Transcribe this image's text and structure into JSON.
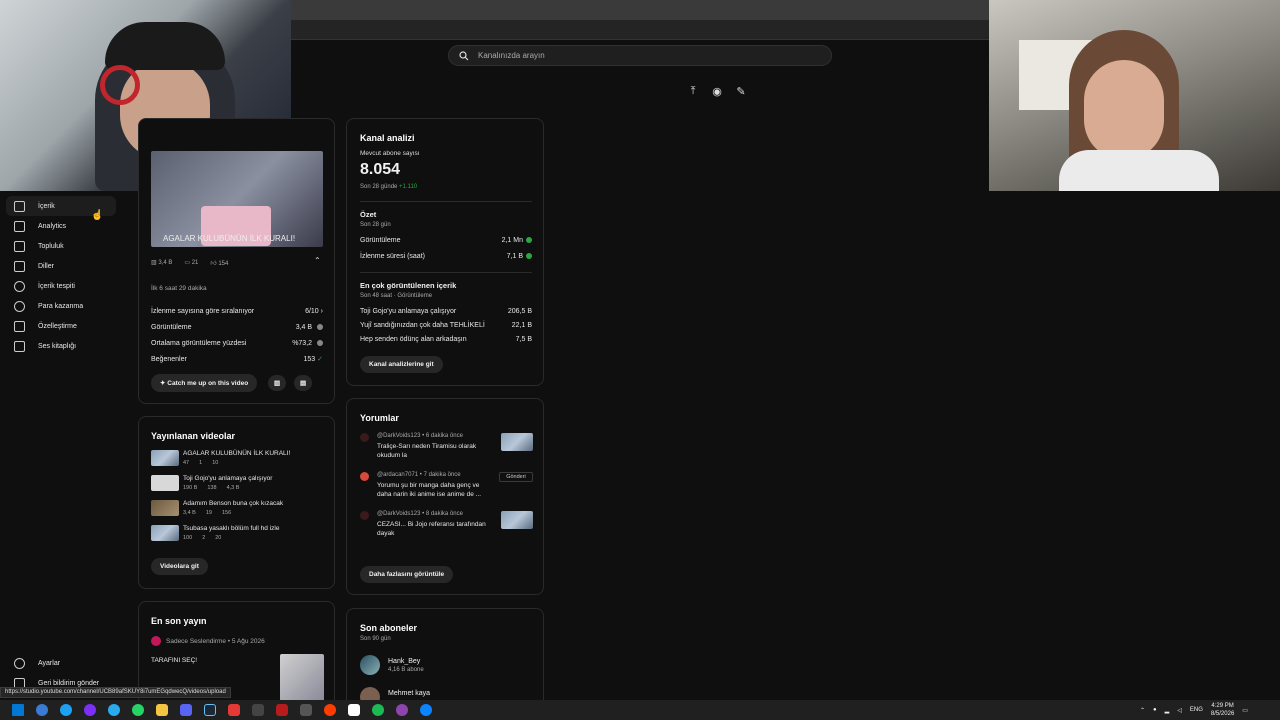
{
  "search": {
    "placeholder": "Kanalınızda arayın"
  },
  "sidebar": {
    "items": [
      {
        "label": "İçerik",
        "icon": "content-icon"
      },
      {
        "label": "Analytics",
        "icon": "analytics-icon"
      },
      {
        "label": "Topluluk",
        "icon": "community-icon"
      },
      {
        "label": "Diller",
        "icon": "subtitles-icon"
      },
      {
        "label": "İçerik tespiti",
        "icon": "copyright-icon"
      },
      {
        "label": "Para kazanma",
        "icon": "dollar-icon"
      },
      {
        "label": "Özelleştirme",
        "icon": "customize-icon"
      },
      {
        "label": "Ses kitaplığı",
        "icon": "audio-library-icon"
      }
    ],
    "settings": "Ayarlar",
    "feedback": "Geri bildirim gönder"
  },
  "latest_video": {
    "title": "AGALAR KULUBÜNÜN İLK KURALI!",
    "views": "3,4 B",
    "comments": "21",
    "likes": "154",
    "period": "İlk 6 saat 29 dakika",
    "rows": [
      {
        "label": "İzlenme sayısına göre sıralanıyor",
        "value": "6/10"
      },
      {
        "label": "Görüntüleme",
        "value": "3,4 B"
      },
      {
        "label": "Ortalama görüntüleme yüzdesi",
        "value": "%73,2"
      },
      {
        "label": "Beğenenler",
        "value": "153"
      }
    ],
    "catch_button": "Catch me up on this video"
  },
  "published": {
    "title": "Yayınlanan videolar",
    "videos": [
      {
        "title": "AGALAR KULUBÜNÜN İLK KURALI!",
        "views": "47",
        "comments": "1",
        "likes": "10"
      },
      {
        "title": "Toji Gojo'yu anlamaya çalışıyor",
        "views": "190 B",
        "comments": "138",
        "likes": "4,3 B"
      },
      {
        "title": "Adamım Benson buna çok kızacak",
        "views": "3,4 B",
        "comments": "19",
        "likes": "156"
      },
      {
        "title": "Tsubasa yasaklı bölüm full hd izle",
        "views": "100",
        "comments": "2",
        "likes": "20"
      }
    ],
    "button": "Videolara git"
  },
  "latest_post": {
    "title": "En son yayın",
    "author": "Sadece Seslendirme",
    "date": "5 Ağu 2026",
    "text": "TARAFINI SEÇ!"
  },
  "analytics": {
    "title": "Kanal analizi",
    "subs_label": "Mevcut abone sayısı",
    "subs_value": "8.054",
    "subs_change_prefix": "Son 28 günde",
    "subs_change": "+1.110",
    "summary_title": "Özet",
    "summary_period": "Son 28 gün",
    "summary_rows": [
      {
        "label": "Görüntüleme",
        "value": "2,1 Mn"
      },
      {
        "label": "İzlenme süresi (saat)",
        "value": "7,1 B"
      }
    ],
    "top_title": "En çok görüntülenen içerik",
    "top_period": "Son 48 saat · Görüntüleme",
    "top_rows": [
      {
        "label": "Toji Gojo'yu anlamaya çalışıyor",
        "value": "206,5 B"
      },
      {
        "label": "Yujî sandığınızdan çok daha TEHLİKELİ",
        "value": "22,1 B"
      },
      {
        "label": "Hep senden ödünç alan arkadaşın",
        "value": "7,5 B"
      }
    ],
    "button": "Kanal analizlerine git"
  },
  "comments": {
    "title": "Yorumlar",
    "items": [
      {
        "author": "@DarkVoids123",
        "time": "6 dakika önce",
        "text": "Traliçe-Sarı neden Tiramisu olarak okudum la",
        "avatar_color": "#3a1a1a"
      },
      {
        "author": "@ardacan7071",
        "time": "7 dakika önce",
        "text": "Yorumu şu bir manga daha genç ve daha narin iki anime ise anime de ...",
        "avatar_color": "#d9483b",
        "badge": "Gönderi"
      },
      {
        "author": "@DarkVoids123",
        "time": "8 dakika önce",
        "text": "CEZASI... Bi Jojo referansı tarafından dayak",
        "avatar_color": "#3a1a1a"
      }
    ],
    "button": "Daha fazlasını görüntüle"
  },
  "subscribers": {
    "title": "Son aboneler",
    "period": "Son 90 gün",
    "items": [
      {
        "name": "Hank_Bey",
        "count": "4,16 B abone"
      },
      {
        "name": "Mehmet kaya",
        "count": ""
      }
    ]
  },
  "status_url": "https://studio.youtube.com/channel/UCB89afSKUY8i7umEGqdwecQ/videos/upload",
  "tray": {
    "lang": "ENG",
    "time": "4:29 PM",
    "date": "8/5/2026"
  }
}
